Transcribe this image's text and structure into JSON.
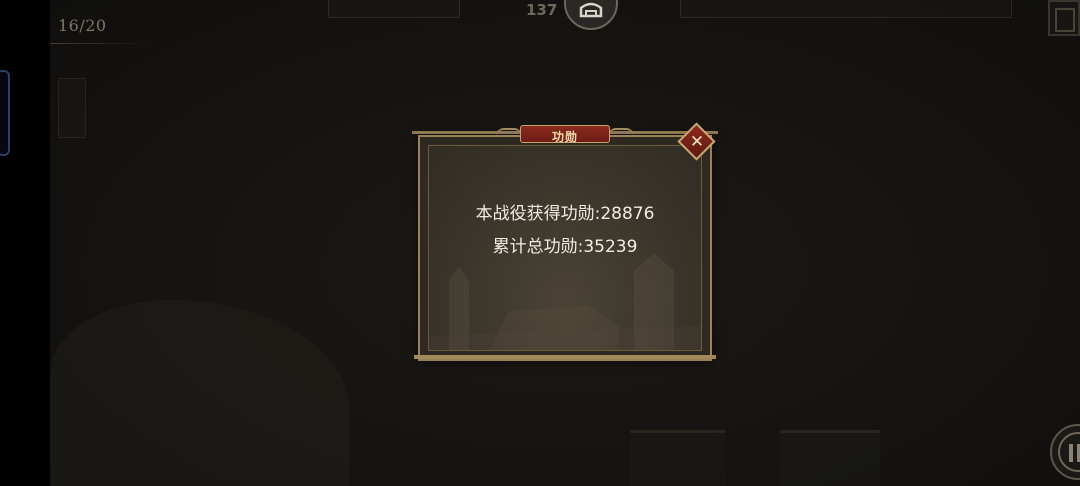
{
  "hud": {
    "progress_counter": "16/20",
    "top_number": "137",
    "top_emblem_icon": "helmet-icon",
    "corner_button_icon": "scroll-icon",
    "info_button_icon": "info-icon"
  },
  "modal": {
    "title": "功勋",
    "close_icon": "close-x-icon",
    "lines": [
      "本战役获得功勋:28876",
      "累计总功勋:35239"
    ]
  },
  "colors": {
    "modal_border": "#9a8256",
    "title_plaque": "#7c2318",
    "close_diamond": "#8e2a1b",
    "text": "#f1ede4"
  }
}
